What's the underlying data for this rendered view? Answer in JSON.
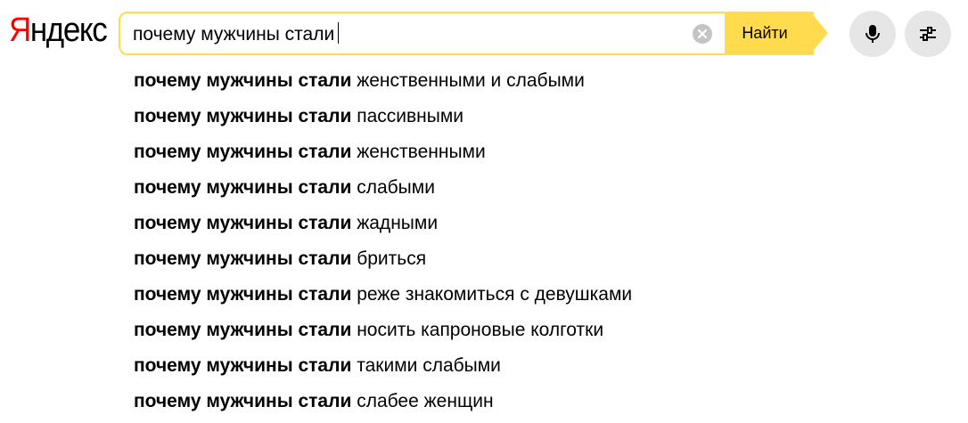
{
  "logo": {
    "first_letter": "Я",
    "rest": "ндекс"
  },
  "search": {
    "value": "почему мужчины стали",
    "button_label": "Найти"
  },
  "icons": {
    "clear": "clear-icon",
    "mic": "microphone-icon",
    "settings": "settings-sliders-icon"
  },
  "colors": {
    "brand_red": "#ff0000",
    "accent_yellow": "#ffdb4d",
    "round_button_bg": "#e6e6e6"
  },
  "suggestions": [
    {
      "prefix": "почему мужчины стали",
      "suffix": " женственными и слабыми"
    },
    {
      "prefix": "почему мужчины стали",
      "suffix": " пассивными"
    },
    {
      "prefix": "почему мужчины стали",
      "suffix": " женственными"
    },
    {
      "prefix": "почему мужчины стали",
      "suffix": " слабыми"
    },
    {
      "prefix": "почему мужчины стали",
      "suffix": " жадными"
    },
    {
      "prefix": "почему мужчины стали",
      "suffix": " бриться"
    },
    {
      "prefix": "почему мужчины стали",
      "suffix": " реже знакомиться с девушками"
    },
    {
      "prefix": "почему мужчины стали",
      "suffix": " носить капроновые колготки"
    },
    {
      "prefix": "почему мужчины стали",
      "suffix": " такими слабыми"
    },
    {
      "prefix": "почему мужчины стали",
      "suffix": " слабее женщин"
    }
  ]
}
